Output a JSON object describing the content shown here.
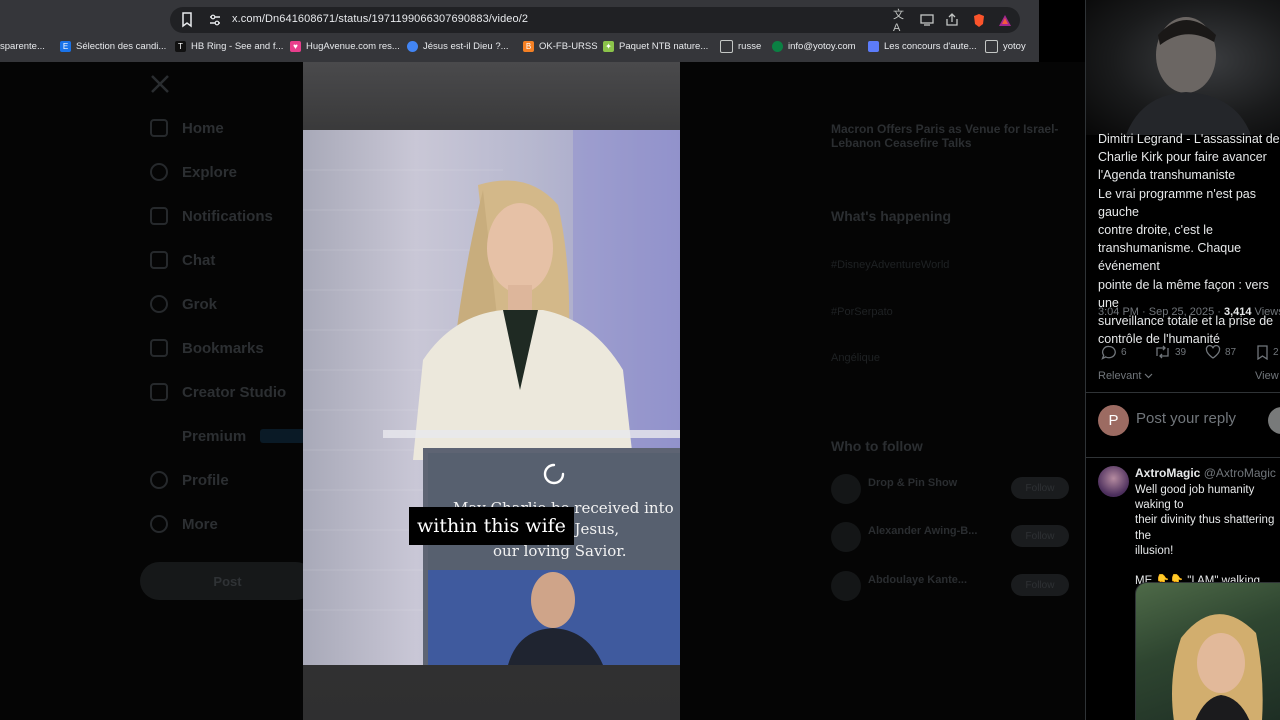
{
  "browser": {
    "url": "x.com/Dn641608671/status/1971199066307690883/video/2",
    "bookmarks": [
      {
        "label": "sparente..."
      },
      {
        "label": "Sélection des candi..."
      },
      {
        "label": "HB Ring - See and f..."
      },
      {
        "label": "HugAvenue.com res..."
      },
      {
        "label": "Jésus est-il Dieu ?..."
      },
      {
        "label": "OK-FB-URSS"
      },
      {
        "label": "Paquet NTB nature..."
      },
      {
        "label": "russe"
      },
      {
        "label": "info@yotoy.com"
      },
      {
        "label": "Les concours d'aute..."
      },
      {
        "label": "yotoy"
      }
    ]
  },
  "x_nav": {
    "items": [
      "Home",
      "Explore",
      "Notifications",
      "Chat",
      "Grok",
      "Bookmarks",
      "Creator Studio",
      "Premium",
      "Profile",
      "More"
    ],
    "post_label": "Post"
  },
  "background_sidebar": {
    "headline_1": "Macron Offers Paris as Venue for Israel-",
    "headline_2": "Lebanon Ceasefire Talks",
    "whats_happening": "What's happening",
    "trend_1": "#DisneyAdventureWorld",
    "trend_2": "#PorSerpato",
    "trend_3": "Angélique",
    "who_to_follow": "Who to follow",
    "follow_1": "Drop & Pin Show",
    "follow_2": "Alexander Awing-B...",
    "follow_3": "Abdoulaye Kante...",
    "follow_label": "Follow"
  },
  "video": {
    "subtitle": "within this wife"
  },
  "tweet": {
    "text": "Dimitri Legrand - L'assassinat de\nCharlie Kirk pour faire avancer\nl'Agenda transhumaniste\n Le vrai programme n'est pas gauche\ncontre droite, c'est le\ntranshumanisme. Chaque événement\npointe de la même façon : vers une\nsurveillance totale et la prise de\ncontrôle de l'humanité",
    "time": "3:04 PM · Sep 25, 2025 · ",
    "views": "3,414",
    "views_label": " Views",
    "replies": "6",
    "reposts": "39",
    "likes": "87",
    "bookmarks": "2",
    "sort": "Relevant",
    "view_link": "View"
  },
  "reply_box": {
    "avatar_letter": "P",
    "placeholder": "Post your reply"
  },
  "reply": {
    "author": "AxtroMagic",
    "handle": "@AxtroMagic · ",
    "text": "Well good job humanity waking to\ntheir divinity thus shattering the\nillusion!\n\nME 👇👇 \"I AM\" walking away from\nPhantom without fear!"
  },
  "colors": {
    "page_bg": "#000000",
    "text_primary": "#e7e9ea",
    "text_secondary": "#71767b",
    "divider": "#2f3336",
    "chrome_bg": "#35363a"
  }
}
